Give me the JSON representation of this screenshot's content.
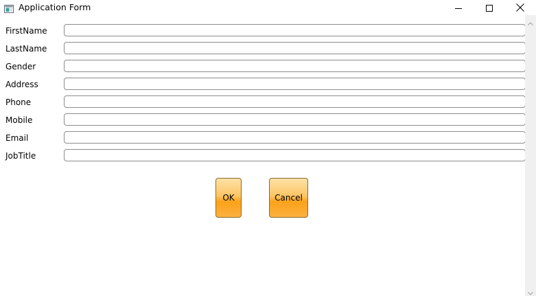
{
  "window": {
    "title": "Application Form"
  },
  "icons": {
    "app": "app-window-icon",
    "minimize": "minimize-icon",
    "maximize": "maximize-icon",
    "close": "close-icon",
    "scroll_up": "chevron-up-icon",
    "scroll_down": "chevron-down-icon"
  },
  "form": {
    "fields": [
      {
        "label": "FirstName",
        "value": ""
      },
      {
        "label": "LastName",
        "value": ""
      },
      {
        "label": "Gender",
        "value": ""
      },
      {
        "label": "Address",
        "value": ""
      },
      {
        "label": "Phone",
        "value": ""
      },
      {
        "label": "Mobile",
        "value": ""
      },
      {
        "label": "Email",
        "value": ""
      },
      {
        "label": "JobTitle",
        "value": ""
      }
    ]
  },
  "buttons": {
    "ok_label": "OK",
    "cancel_label": "Cancel"
  },
  "colors": {
    "button_orange": "#fba21a",
    "button_orange_light": "#fde2a6",
    "input_border": "#8c8c8c",
    "scrollbar_track": "#f0f0f0"
  }
}
